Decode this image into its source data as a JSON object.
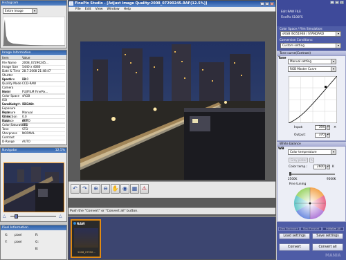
{
  "app_title": "FinePix Studio - [Adjust Image Quality:2008_07290245.RAF(12.5%)]",
  "menu": [
    "File",
    "Edit",
    "View",
    "Window",
    "Help"
  ],
  "histogram": {
    "title": "Histogram",
    "selected": "Entire Image"
  },
  "image_info": {
    "title": "Image Information",
    "header": [
      "Item",
      "Value"
    ],
    "rows": [
      [
        "File Name",
        "2008_07290245..."
      ],
      [
        "Image Size",
        "5440 x 4080"
      ],
      [
        "Date & Time",
        "28.7.2008 21:48:47"
      ],
      [
        "Shutter Speed",
        "30"
      ],
      [
        "Aperture",
        "F8.0"
      ],
      [
        "Quality Mode",
        "CCD-RAW"
      ],
      [
        "Camera Model",
        "FUJIFILM FinePix..."
      ],
      [
        "Lens",
        ""
      ],
      [
        "Color Space",
        "sRGB"
      ],
      [
        "ISO Sensitivity",
        "ISO100"
      ],
      [
        "Focal Length",
        "10.2mm"
      ],
      [
        "Exposure Mode",
        "Manual"
      ],
      [
        "Exposure Correction",
        "0.0"
      ],
      [
        "White Balance",
        "AUTO"
      ],
      [
        "Flash",
        "OFF"
      ],
      [
        "Color(Saturation)",
        "STD"
      ],
      [
        "Tone",
        "STD"
      ],
      [
        "Sharpness",
        "NORMAL"
      ],
      [
        "Contrast",
        ""
      ],
      [
        "D-Range",
        "AUTO"
      ]
    ]
  },
  "navigator": {
    "title": "Navigator",
    "zoom": "12.5%"
  },
  "pixel_info": {
    "title": "Pixel Information",
    "rows": [
      [
        "X:",
        "pixel",
        "R:"
      ],
      [
        "Y:",
        "pixel",
        "G:"
      ],
      [
        "",
        "",
        "B:"
      ]
    ]
  },
  "status": "Push the \"Convert\" or \"Convert all\" button.",
  "thumbnail": {
    "badge": "RAW",
    "label": "2008_07290..."
  },
  "right_panel": {
    "title": "Edit RAW FILE",
    "model": "FinePix S100FS",
    "color_space_label": "Color Space / Film Simulation:",
    "color_space_value": "sRGB ISO51948 / STANDARD",
    "conversion_label": "Conversion Conditions:",
    "conversion_value": "Custom setting",
    "tone_curve_title": "Tone curve(Contrast)",
    "tone_label": "Tone",
    "tone_mode": "Manual setting",
    "curve_channel": "RGB Master Curve",
    "input_label": "Input:",
    "input_value": "394",
    "output_label": "Output:",
    "output_value": "370",
    "wb_title": "White balance",
    "wb_label": "WB",
    "wb_mode": "Color temperature",
    "gray_picker": "Gray picker",
    "color_temp_label": "Color temp.:",
    "color_temp_value": "2600",
    "color_temp_unit": "K",
    "temp_min": "2500K",
    "temp_max": "9500K",
    "fine_tuning": "Fine tuning",
    "btn_step_backward": "Step Backward",
    "btn_step_forward": "Step Forward",
    "btn_initialize": "Initialize All",
    "btn_load": "Load settings",
    "btn_save": "Save settings",
    "btn_convert": "Convert",
    "btn_convert_all": "Convert all",
    "watermark": "MANIA"
  },
  "toolbar_icons": [
    "rotate-left-icon",
    "rotate-right-icon",
    "zoom-in-icon",
    "zoom-out-icon",
    "hand-icon",
    "eye-icon",
    "grid-icon",
    "warning-icon"
  ]
}
